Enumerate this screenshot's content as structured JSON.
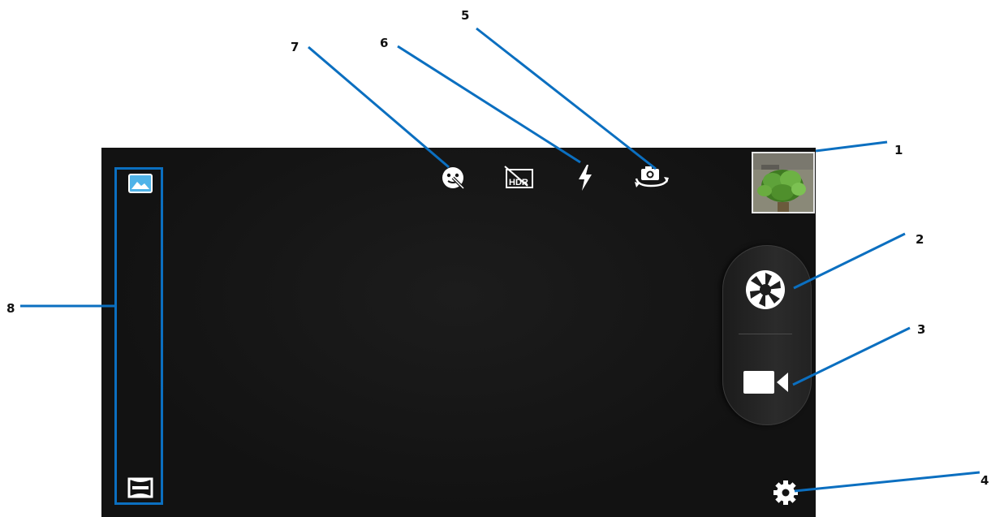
{
  "camera": {
    "top_icons": [
      {
        "name": "face-detection-off-icon"
      },
      {
        "name": "hdr-off-icon",
        "label": "HDR"
      },
      {
        "name": "flash-icon"
      },
      {
        "name": "switch-camera-icon"
      }
    ],
    "thumbnail": {
      "name": "last-photo-thumbnail",
      "subject": "potted green plant"
    },
    "shutter_icon": "shutter-icon",
    "video_icon": "video-camera-icon",
    "settings_icon": "gear-icon",
    "modes": [
      {
        "name": "photo-mode-icon",
        "selected": true
      },
      {
        "name": "panorama-mode-icon",
        "selected": false
      }
    ]
  },
  "callouts": {
    "n1": "1",
    "n2": "2",
    "n3": "3",
    "n4": "4",
    "n5": "5",
    "n6": "6",
    "n7": "7",
    "n8": "8"
  },
  "colors": {
    "callout_line": "#0b6fc0",
    "mode_accent": "#4fb3e8",
    "screen_bg": "#141414"
  }
}
